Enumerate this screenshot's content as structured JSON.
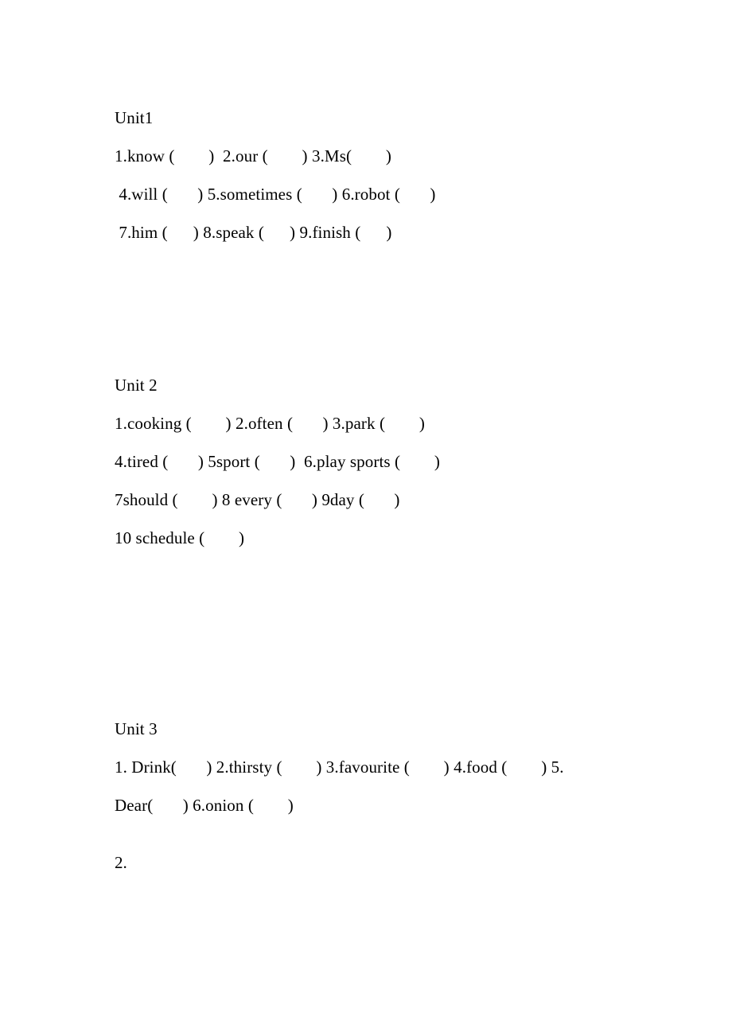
{
  "document": {
    "title": "Unit Vocabulary Worksheet",
    "background_color": "#ffffff",
    "text_color": "#000000"
  },
  "sections": [
    {
      "heading": "Unit1",
      "lines": [
        "1.know (        )  2.our (        ) 3.Ms(        )",
        " 4.will (       ) 5.sometimes (       ) 6.robot (       )",
        " 7.him (      ) 8.speak (      ) 9.finish (      )"
      ]
    },
    {
      "heading": "Unit 2",
      "lines": [
        "1.cooking (        ) 2.often (       ) 3.park (        )",
        "4.tired (       ) 5sport (       )  6.play sports (        )",
        "7should (        ) 8 every (       ) 9day (       )",
        "10 schedule (        )"
      ]
    },
    {
      "heading": "Unit 3",
      "lines": [
        "1. Drink(       ) 2.thirsty (        ) 3.favourite (        ) 4.food (        ) 5.",
        "Dear(       ) 6.onion (        )"
      ],
      "trailing_marker": "2."
    }
  ]
}
